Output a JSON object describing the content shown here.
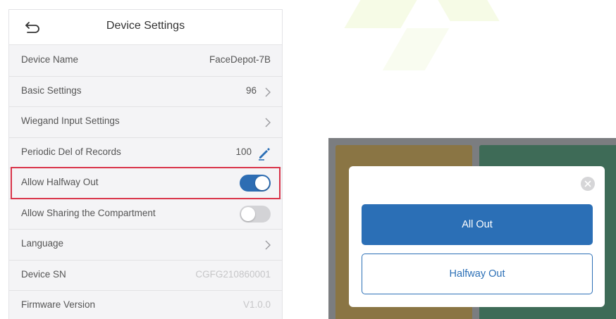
{
  "header": {
    "title": "Device Settings"
  },
  "rows": [
    {
      "label": "Device Name",
      "value": "FaceDepot-7B"
    },
    {
      "label": "Basic Settings",
      "value": "96"
    },
    {
      "label": "Wiegand Input Settings",
      "value": ""
    },
    {
      "label": "Periodic Del of Records",
      "value": "100"
    },
    {
      "label": "Allow Halfway Out",
      "toggle": "on"
    },
    {
      "label": "Allow Sharing the Compartment",
      "toggle": "off"
    },
    {
      "label": "Language",
      "value": ""
    },
    {
      "label": "Device SN",
      "value": "CGFG210860001"
    },
    {
      "label": "Firmware Version",
      "value": "V1.0.0"
    }
  ],
  "dialog": {
    "primary_label": "All Out",
    "secondary_label": "Halfway Out"
  },
  "colors": {
    "accent": "#2b6fb6",
    "highlight": "#d9344a",
    "toggle_on": "#2d6db3",
    "toggle_off": "#d3d3d6"
  },
  "icons": {
    "back": "back-arrow-icon",
    "chevron": "chevron-right-icon",
    "edit": "pencil-icon",
    "close": "close-icon"
  }
}
